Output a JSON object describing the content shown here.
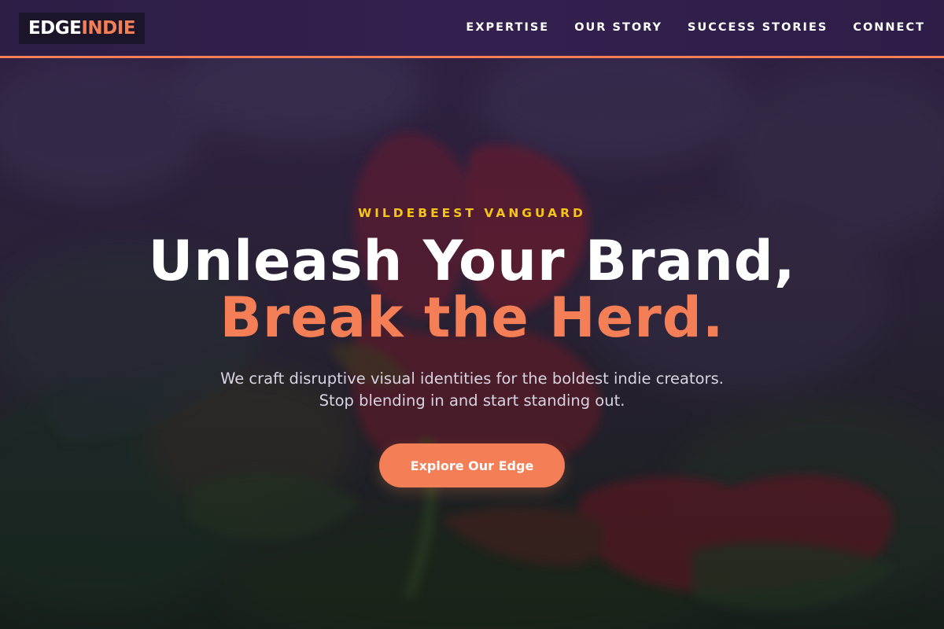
{
  "brand": {
    "logo_part1": "EDGE",
    "logo_part2": "INDIE"
  },
  "nav": {
    "items": [
      {
        "label": "EXPERTISE"
      },
      {
        "label": "OUR STORY"
      },
      {
        "label": "SUCCESS STORIES"
      },
      {
        "label": "CONNECT"
      }
    ]
  },
  "hero": {
    "eyebrow": "WILDEBEEST VANGUARD",
    "headline_line1": "Unleash Your Brand,",
    "headline_line2": "Break the Herd.",
    "subtext_line1": "We craft disruptive visual identities for the boldest indie creators.",
    "subtext_line2": "Stop blending in and start standing out.",
    "cta_label": "Explore Our Edge"
  },
  "colors": {
    "accent": "#f47e55",
    "eyebrow": "#f5c518",
    "nav_bg": "#2f1f49",
    "text": "#ffffff"
  },
  "background": {
    "subject": "flower-photo"
  }
}
